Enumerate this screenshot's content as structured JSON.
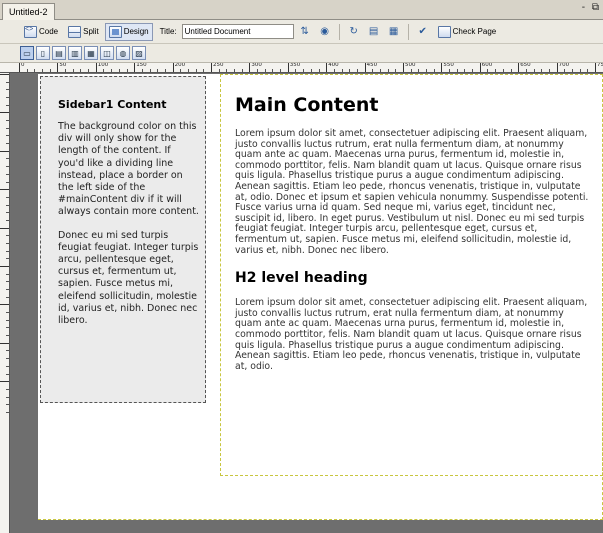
{
  "window": {
    "tab_title": "Untitled-2",
    "controls": "- ⧉"
  },
  "toolbar": {
    "code_label": "Code",
    "split_label": "Split",
    "design_label": "Design",
    "title_label": "Title:",
    "title_value": "Untitled Document",
    "check_page_label": "Check Page"
  },
  "ruler": {
    "h_labels": [
      "0",
      "50",
      "100",
      "150",
      "200",
      "250",
      "300",
      "350",
      "400",
      "450",
      "500",
      "550",
      "600",
      "650",
      "700",
      "750"
    ],
    "v_labels": [
      "50",
      "100",
      "150",
      "200",
      "250",
      "300",
      "350",
      "400"
    ]
  },
  "sidebar": {
    "heading": "Sidebar1 Content",
    "paragraph1": "The background color on this div will only show for the length of the content. If you'd like a dividing line instead, place a border on the left side of the #mainContent div if it will always contain more content.",
    "paragraph2": "Donec eu mi sed turpis feugiat feugiat. Integer turpis arcu, pellentesque eget, cursus et, fermentum ut, sapien. Fusce metus mi, eleifend sollicitudin, molestie id, varius et, nibh. Donec nec libero."
  },
  "main": {
    "heading": "Main Content",
    "paragraph1": "Lorem ipsum dolor sit amet, consectetuer adipiscing elit. Praesent aliquam, justo convallis luctus rutrum, erat nulla fermentum diam, at nonummy quam ante ac quam. Maecenas urna purus, fermentum id, molestie in, commodo porttitor, felis. Nam blandit quam ut lacus. Quisque ornare risus quis ligula. Phasellus tristique purus a augue condimentum adipiscing. Aenean sagittis. Etiam leo pede, rhoncus venenatis, tristique in, vulputate at, odio. Donec et ipsum et sapien vehicula nonummy. Suspendisse potenti. Fusce varius urna id quam. Sed neque mi, varius eget, tincidunt nec, suscipit id, libero. In eget purus. Vestibulum ut nisl. Donec eu mi sed turpis feugiat feugiat. Integer turpis arcu, pellentesque eget, cursus et, fermentum ut, sapien. Fusce metus mi, eleifend sollicitudin, molestie id, varius et, nibh. Donec nec libero.",
    "subheading": "H2 level heading",
    "paragraph2": "Lorem ipsum dolor sit amet, consectetuer adipiscing elit. Praesent aliquam, justo convallis luctus rutrum, erat nulla fermentum diam, at nonummy quam ante ac quam. Maecenas urna purus, fermentum id, molestie in, commodo porttitor, felis. Nam blandit quam ut lacus. Quisque ornare risus quis ligula. Phasellus tristique purus a augue condimentum adipiscing. Aenean sagittis. Etiam leo pede, rhoncus venenatis, tristique in, vulputate at, odio."
  },
  "colors": {
    "canvas": "#6e6e6e",
    "sidebar_bg": "#ebebeb",
    "guide": "#c8c640"
  }
}
